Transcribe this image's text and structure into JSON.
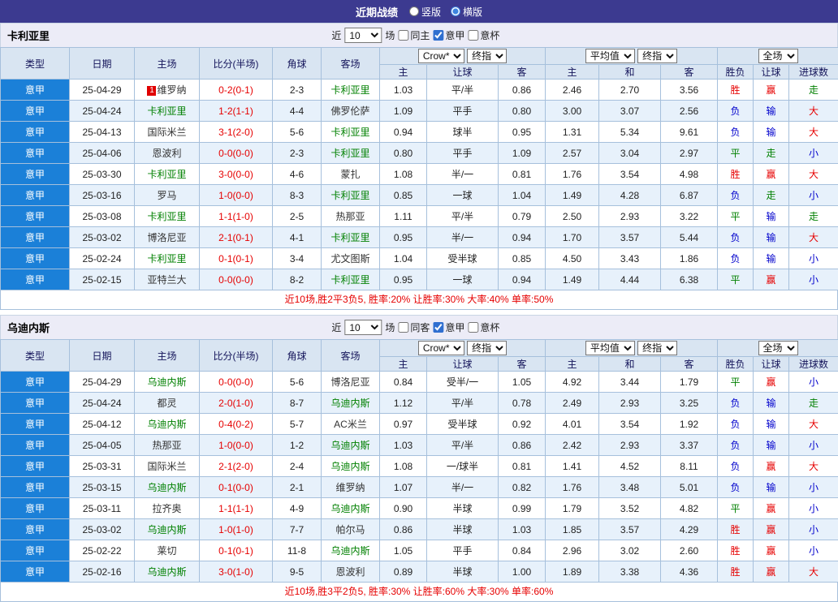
{
  "topbar": {
    "title": "近期战绩",
    "radios": [
      {
        "label": "竖版",
        "selected": false
      },
      {
        "label": "横版",
        "selected": true
      }
    ]
  },
  "colors": {
    "topbar_bg": "#3c3a90",
    "league_cell_bg": "#1b80d8",
    "win_red": "#e60000",
    "loss_blue": "#0000cc",
    "draw_green": "#008000",
    "subject_team_green": "#008000",
    "score_red": "#e60000",
    "header_bg": "#d9e5f2",
    "alt_row_bg": "#e7f1fb"
  },
  "headers": {
    "type": "类型",
    "date": "日期",
    "home": "主场",
    "score": "比分(半场)",
    "corner": "角球",
    "away": "客场",
    "odds_home": "主",
    "handicap": "让球",
    "odds_away": "客",
    "avg_home": "主",
    "avg_draw": "和",
    "avg_away": "客",
    "result": "胜负",
    "handicap_result": "让球",
    "goals": "进球数"
  },
  "sections": [
    {
      "team": "卡利亚里",
      "filter": {
        "near_label": "近",
        "count": "10",
        "unit_label": "场",
        "checkboxes": [
          {
            "label": "同主",
            "checked": false
          },
          {
            "label": "意甲",
            "checked": true
          },
          {
            "label": "意杯",
            "checked": false
          }
        ]
      },
      "dropdowns": {
        "source": "Crow*",
        "source_time": "终指",
        "avg": "平均值",
        "avg_time": "终指",
        "scope": "全场"
      },
      "rows": [
        {
          "league": "意甲",
          "date": "25-04-29",
          "home": "维罗纳",
          "home_badge": "1",
          "home_subject": false,
          "score": "0-2(0-1)",
          "corner": "2-3",
          "away": "卡利亚里",
          "away_subject": true,
          "odds_home": "1.03",
          "handicap": "平/半",
          "odds_away": "0.86",
          "avg_home": "2.46",
          "avg_draw": "2.70",
          "avg_away": "3.56",
          "result": "胜",
          "handicap_result": "赢",
          "goals": "走"
        },
        {
          "league": "意甲",
          "date": "25-04-24",
          "home": "卡利亚里",
          "home_subject": true,
          "score": "1-2(1-1)",
          "corner": "4-4",
          "away": "佛罗伦萨",
          "away_subject": false,
          "odds_home": "1.09",
          "handicap": "平手",
          "odds_away": "0.80",
          "avg_home": "3.00",
          "avg_draw": "3.07",
          "avg_away": "2.56",
          "result": "负",
          "handicap_result": "输",
          "goals": "大"
        },
        {
          "league": "意甲",
          "date": "25-04-13",
          "home": "国际米兰",
          "home_subject": false,
          "score": "3-1(2-0)",
          "corner": "5-6",
          "away": "卡利亚里",
          "away_subject": true,
          "odds_home": "0.94",
          "handicap": "球半",
          "odds_away": "0.95",
          "avg_home": "1.31",
          "avg_draw": "5.34",
          "avg_away": "9.61",
          "result": "负",
          "handicap_result": "输",
          "goals": "大"
        },
        {
          "league": "意甲",
          "date": "25-04-06",
          "home": "恩波利",
          "home_subject": false,
          "score": "0-0(0-0)",
          "corner": "2-3",
          "away": "卡利亚里",
          "away_subject": true,
          "odds_home": "0.80",
          "handicap": "平手",
          "odds_away": "1.09",
          "avg_home": "2.57",
          "avg_draw": "3.04",
          "avg_away": "2.97",
          "result": "平",
          "handicap_result": "走",
          "goals": "小"
        },
        {
          "league": "意甲",
          "date": "25-03-30",
          "home": "卡利亚里",
          "home_subject": true,
          "score": "3-0(0-0)",
          "corner": "4-6",
          "away": "蒙扎",
          "away_subject": false,
          "odds_home": "1.08",
          "handicap": "半/一",
          "odds_away": "0.81",
          "avg_home": "1.76",
          "avg_draw": "3.54",
          "avg_away": "4.98",
          "result": "胜",
          "handicap_result": "赢",
          "goals": "大"
        },
        {
          "league": "意甲",
          "date": "25-03-16",
          "home": "罗马",
          "home_subject": false,
          "score": "1-0(0-0)",
          "corner": "8-3",
          "away": "卡利亚里",
          "away_subject": true,
          "odds_home": "0.85",
          "handicap": "一球",
          "odds_away": "1.04",
          "avg_home": "1.49",
          "avg_draw": "4.28",
          "avg_away": "6.87",
          "result": "负",
          "handicap_result": "走",
          "goals": "小"
        },
        {
          "league": "意甲",
          "date": "25-03-08",
          "home": "卡利亚里",
          "home_subject": true,
          "score": "1-1(1-0)",
          "corner": "2-5",
          "away": "热那亚",
          "away_subject": false,
          "odds_home": "1.11",
          "handicap": "平/半",
          "odds_away": "0.79",
          "avg_home": "2.50",
          "avg_draw": "2.93",
          "avg_away": "3.22",
          "result": "平",
          "handicap_result": "输",
          "goals": "走"
        },
        {
          "league": "意甲",
          "date": "25-03-02",
          "home": "博洛尼亚",
          "home_subject": false,
          "score": "2-1(0-1)",
          "corner": "4-1",
          "away": "卡利亚里",
          "away_subject": true,
          "odds_home": "0.95",
          "handicap": "半/一",
          "odds_away": "0.94",
          "avg_home": "1.70",
          "avg_draw": "3.57",
          "avg_away": "5.44",
          "result": "负",
          "handicap_result": "输",
          "goals": "大"
        },
        {
          "league": "意甲",
          "date": "25-02-24",
          "home": "卡利亚里",
          "home_subject": true,
          "score": "0-1(0-1)",
          "corner": "3-4",
          "away": "尤文图斯",
          "away_subject": false,
          "odds_home": "1.04",
          "handicap": "受半球",
          "odds_away": "0.85",
          "avg_home": "4.50",
          "avg_draw": "3.43",
          "avg_away": "1.86",
          "result": "负",
          "handicap_result": "输",
          "goals": "小"
        },
        {
          "league": "意甲",
          "date": "25-02-15",
          "home": "亚特兰大",
          "home_subject": false,
          "score": "0-0(0-0)",
          "corner": "8-2",
          "away": "卡利亚里",
          "away_subject": true,
          "odds_home": "0.95",
          "handicap": "一球",
          "odds_away": "0.94",
          "avg_home": "1.49",
          "avg_draw": "4.44",
          "avg_away": "6.38",
          "result": "平",
          "handicap_result": "赢",
          "goals": "小"
        }
      ],
      "summary": "近10场,胜2平3负5, 胜率:20% 让胜率:30% 大率:40% 单率:50%"
    },
    {
      "team": "乌迪内斯",
      "filter": {
        "near_label": "近",
        "count": "10",
        "unit_label": "场",
        "checkboxes": [
          {
            "label": "同客",
            "checked": false
          },
          {
            "label": "意甲",
            "checked": true
          },
          {
            "label": "意杯",
            "checked": false
          }
        ]
      },
      "dropdowns": {
        "source": "Crow*",
        "source_time": "终指",
        "avg": "平均值",
        "avg_time": "终指",
        "scope": "全场"
      },
      "rows": [
        {
          "league": "意甲",
          "date": "25-04-29",
          "home": "乌迪内斯",
          "home_subject": true,
          "score": "0-0(0-0)",
          "corner": "5-6",
          "away": "博洛尼亚",
          "away_subject": false,
          "odds_home": "0.84",
          "handicap": "受半/一",
          "odds_away": "1.05",
          "avg_home": "4.92",
          "avg_draw": "3.44",
          "avg_away": "1.79",
          "result": "平",
          "handicap_result": "赢",
          "goals": "小"
        },
        {
          "league": "意甲",
          "date": "25-04-24",
          "home": "都灵",
          "home_subject": false,
          "score": "2-0(1-0)",
          "corner": "8-7",
          "away": "乌迪内斯",
          "away_subject": true,
          "odds_home": "1.12",
          "handicap": "平/半",
          "odds_away": "0.78",
          "avg_home": "2.49",
          "avg_draw": "2.93",
          "avg_away": "3.25",
          "result": "负",
          "handicap_result": "输",
          "goals": "走"
        },
        {
          "league": "意甲",
          "date": "25-04-12",
          "home": "乌迪内斯",
          "home_subject": true,
          "score": "0-4(0-2)",
          "corner": "5-7",
          "away": "AC米兰",
          "away_subject": false,
          "odds_home": "0.97",
          "handicap": "受半球",
          "odds_away": "0.92",
          "avg_home": "4.01",
          "avg_draw": "3.54",
          "avg_away": "1.92",
          "result": "负",
          "handicap_result": "输",
          "goals": "大"
        },
        {
          "league": "意甲",
          "date": "25-04-05",
          "home": "热那亚",
          "home_subject": false,
          "score": "1-0(0-0)",
          "corner": "1-2",
          "away": "乌迪内斯",
          "away_subject": true,
          "odds_home": "1.03",
          "handicap": "平/半",
          "odds_away": "0.86",
          "avg_home": "2.42",
          "avg_draw": "2.93",
          "avg_away": "3.37",
          "result": "负",
          "handicap_result": "输",
          "goals": "小"
        },
        {
          "league": "意甲",
          "date": "25-03-31",
          "home": "国际米兰",
          "home_subject": false,
          "score": "2-1(2-0)",
          "corner": "2-4",
          "away": "乌迪内斯",
          "away_subject": true,
          "odds_home": "1.08",
          "handicap": "一/球半",
          "odds_away": "0.81",
          "avg_home": "1.41",
          "avg_draw": "4.52",
          "avg_away": "8.11",
          "result": "负",
          "handicap_result": "赢",
          "goals": "大"
        },
        {
          "league": "意甲",
          "date": "25-03-15",
          "home": "乌迪内斯",
          "home_subject": true,
          "score": "0-1(0-0)",
          "corner": "2-1",
          "away": "维罗纳",
          "away_subject": false,
          "odds_home": "1.07",
          "handicap": "半/一",
          "odds_away": "0.82",
          "avg_home": "1.76",
          "avg_draw": "3.48",
          "avg_away": "5.01",
          "result": "负",
          "handicap_result": "输",
          "goals": "小"
        },
        {
          "league": "意甲",
          "date": "25-03-11",
          "home": "拉齐奥",
          "home_subject": false,
          "score": "1-1(1-1)",
          "corner": "4-9",
          "away": "乌迪内斯",
          "away_subject": true,
          "odds_home": "0.90",
          "handicap": "半球",
          "odds_away": "0.99",
          "avg_home": "1.79",
          "avg_draw": "3.52",
          "avg_away": "4.82",
          "result": "平",
          "handicap_result": "赢",
          "goals": "小"
        },
        {
          "league": "意甲",
          "date": "25-03-02",
          "home": "乌迪内斯",
          "home_subject": true,
          "score": "1-0(1-0)",
          "corner": "7-7",
          "away": "帕尔马",
          "away_subject": false,
          "odds_home": "0.86",
          "handicap": "半球",
          "odds_away": "1.03",
          "avg_home": "1.85",
          "avg_draw": "3.57",
          "avg_away": "4.29",
          "result": "胜",
          "handicap_result": "赢",
          "goals": "小"
        },
        {
          "league": "意甲",
          "date": "25-02-22",
          "home": "莱切",
          "home_subject": false,
          "score": "0-1(0-1)",
          "corner": "11-8",
          "away": "乌迪内斯",
          "away_subject": true,
          "odds_home": "1.05",
          "handicap": "平手",
          "odds_away": "0.84",
          "avg_home": "2.96",
          "avg_draw": "3.02",
          "avg_away": "2.60",
          "result": "胜",
          "handicap_result": "赢",
          "goals": "小"
        },
        {
          "league": "意甲",
          "date": "25-02-16",
          "home": "乌迪内斯",
          "home_subject": true,
          "score": "3-0(1-0)",
          "corner": "9-5",
          "away": "恩波利",
          "away_subject": false,
          "odds_home": "0.89",
          "handicap": "半球",
          "odds_away": "1.00",
          "avg_home": "1.89",
          "avg_draw": "3.38",
          "avg_away": "4.36",
          "result": "胜",
          "handicap_result": "赢",
          "goals": "大"
        }
      ],
      "summary": "近10场,胜3平2负5, 胜率:30% 让胜率:60% 大率:30% 单率:60%"
    }
  ]
}
